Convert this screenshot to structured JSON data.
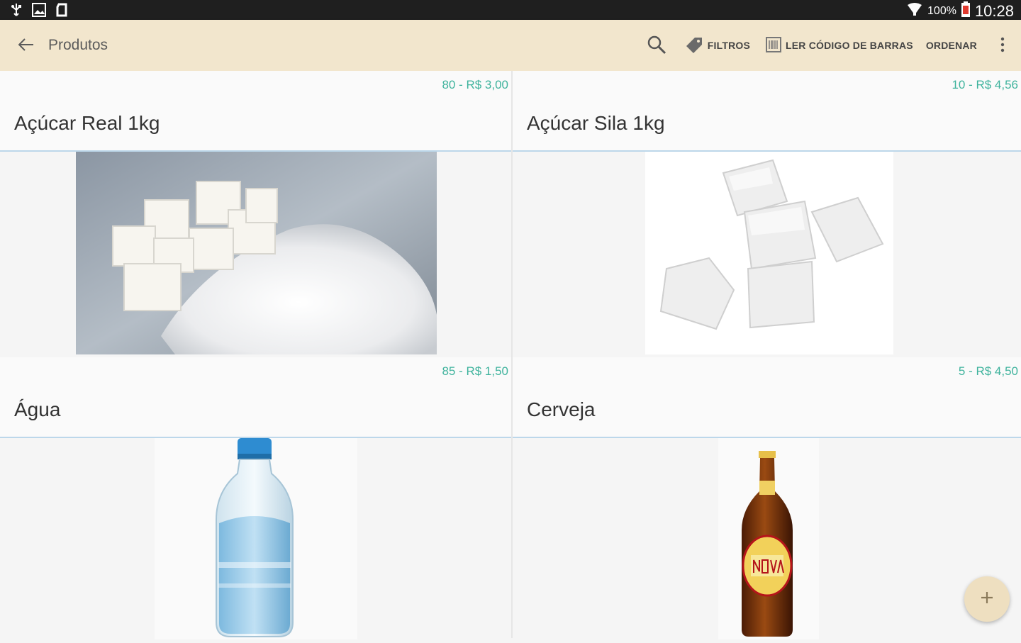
{
  "status_bar": {
    "battery": "100%",
    "time": "10:28",
    "icons_left": [
      "usb-icon",
      "image-icon",
      "app-icon"
    ],
    "icons_right": [
      "wifi-icon",
      "battery-icon"
    ]
  },
  "toolbar": {
    "title": "Produtos",
    "back_icon": "arrow-back-icon",
    "actions": {
      "search_icon": "search-icon",
      "filters_label": "FILTROS",
      "barcode_label": "LER CÓDIGO DE BARRAS",
      "order_label": "ORDENAR",
      "more_icon": "more-vert-icon"
    },
    "background": "#f2e6cd"
  },
  "products": [
    {
      "name": "Açúcar Real 1kg",
      "qty_price": "80 - R$ 3,00",
      "image": "sugar-pile-image"
    },
    {
      "name": "Açúcar Sila 1kg",
      "qty_price": "10 - R$ 4,56",
      "image": "sugar-cubes-image"
    },
    {
      "name": "Água",
      "qty_price": "85 - R$ 1,50",
      "image": "water-bottle-image"
    },
    {
      "name": "Cerveja",
      "qty_price": "5 - R$ 4,50",
      "image": "beer-bottle-image"
    }
  ],
  "fab": {
    "icon": "plus-icon"
  },
  "colors": {
    "accent_price": "#3fb39d",
    "divider_blue": "#bcd7ea",
    "fab": "#eedfc0"
  }
}
